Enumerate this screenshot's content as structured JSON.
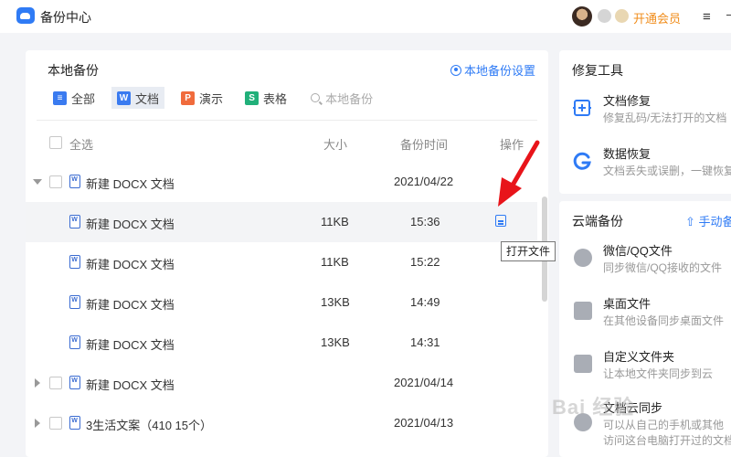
{
  "app": {
    "title": "备份中心",
    "vip_label": "开通会员",
    "menu_icon": "≡",
    "dash_icon": "–"
  },
  "local": {
    "title": "本地备份",
    "settings_label": "本地备份设置",
    "filters": [
      {
        "label": "全部",
        "icon": "all-icon",
        "color": "#3a7bf0",
        "glyph": "≡"
      },
      {
        "label": "文档",
        "icon": "word-icon",
        "color": "#3a7bf0",
        "glyph": "W"
      },
      {
        "label": "演示",
        "icon": "ppt-icon",
        "color": "#f06b3c",
        "glyph": "P"
      },
      {
        "label": "表格",
        "icon": "excel-icon",
        "color": "#21b07a",
        "glyph": "S"
      }
    ],
    "search_placeholder": "本地备份",
    "columns": {
      "select_all": "全选",
      "size": "大小",
      "time": "备份时间",
      "action": "操作"
    },
    "rows": [
      {
        "name": "新建 DOCX 文档",
        "size": "",
        "time": "2021/04/22",
        "group": true,
        "expanded": true
      },
      {
        "name": "新建 DOCX 文档",
        "size": "11KB",
        "time": "15:36",
        "group": false,
        "highlight": true
      },
      {
        "name": "新建 DOCX 文档",
        "size": "11KB",
        "time": "15:22",
        "group": false
      },
      {
        "name": "新建 DOCX 文档",
        "size": "13KB",
        "time": "14:49",
        "group": false
      },
      {
        "name": "新建 DOCX 文档",
        "size": "13KB",
        "time": "14:31",
        "group": false
      },
      {
        "name": "新建 DOCX 文档",
        "size": "",
        "time": "2021/04/14",
        "group": true,
        "expanded": false
      },
      {
        "name": "3生活文案（410 15个）",
        "size": "",
        "time": "2021/04/13",
        "group": true,
        "expanded": false
      }
    ],
    "tooltip": "打开文件"
  },
  "repair": {
    "title": "修复工具",
    "items": [
      {
        "title": "文档修复",
        "desc": "修复乱码/无法打开的文档"
      },
      {
        "title": "数据恢复",
        "desc": "文档丢失或误删，一键恢复"
      }
    ]
  },
  "cloud": {
    "title": "云端备份",
    "upload_label": "手动备",
    "items": [
      {
        "title": "微信/QQ文件",
        "desc": "同步微信/QQ接收的文件"
      },
      {
        "title": "桌面文件",
        "desc": "在其他设备同步桌面文件"
      },
      {
        "title": "自定义文件夹",
        "desc": "让本地文件夹同步到云"
      },
      {
        "title": "文档云同步",
        "desc": "可以从自己的手机或其他"
      },
      {
        "title": "",
        "desc": "访问这台电脑打开过的文档"
      }
    ]
  },
  "watermark": "Bai 经验"
}
